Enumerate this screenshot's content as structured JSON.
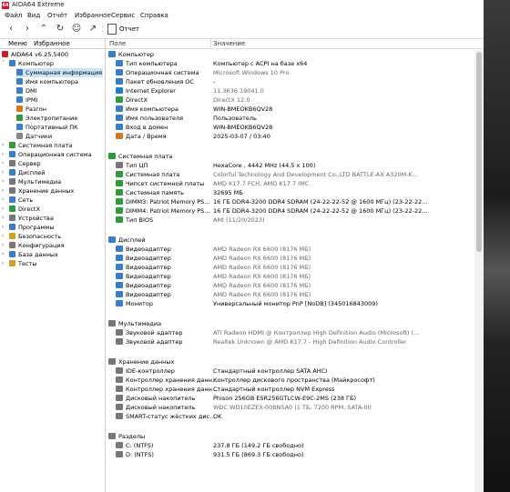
{
  "app": {
    "title": "AIDA64 Extreme",
    "icon_text": "64"
  },
  "menu": [
    "Файл",
    "Вид",
    "Отчёт",
    "Избранное",
    "Сервис",
    "Справка"
  ],
  "toolbar": {
    "report_label": "Отчет"
  },
  "sidebar": {
    "tabs": [
      "Меню",
      "Избранное"
    ],
    "tree": [
      {
        "label": "AIDA64 v6.25.5400",
        "icon": "aida-icon",
        "color": "#c8202b",
        "level": 0
      },
      {
        "label": "Компьютер",
        "icon": "computer-icon",
        "color": "#3a7ec9",
        "level": 1,
        "expanded": true
      },
      {
        "label": "Суммарная информация",
        "icon": "summary-icon",
        "color": "#3a7ec9",
        "level": 2,
        "selected": true
      },
      {
        "label": "Имя компьютера",
        "icon": "computer-name-icon",
        "color": "#3a7ec9",
        "level": 2
      },
      {
        "label": "DMI",
        "icon": "dmi-icon",
        "color": "#3a7ec9",
        "level": 2
      },
      {
        "label": "IPMI",
        "icon": "ipmi-icon",
        "color": "#3a7ec9",
        "level": 2
      },
      {
        "label": "Разгон",
        "icon": "overclock-icon",
        "color": "#d07b1f",
        "level": 2
      },
      {
        "label": "Электропитание",
        "icon": "power-icon",
        "color": "#2f9a3a",
        "level": 2
      },
      {
        "label": "Портативный ПК",
        "icon": "laptop-icon",
        "color": "#3a7ec9",
        "level": 2
      },
      {
        "label": "Датчики",
        "icon": "sensor-icon",
        "color": "#888888",
        "level": 2
      },
      {
        "label": "Системная плата",
        "icon": "motherboard-icon",
        "color": "#2f9a3a",
        "level": 1
      },
      {
        "label": "Операционная система",
        "icon": "os-icon",
        "color": "#3a7ec9",
        "level": 1
      },
      {
        "label": "Сервер",
        "icon": "server-icon",
        "color": "#777777",
        "level": 1
      },
      {
        "label": "Дисплей",
        "icon": "display-icon",
        "color": "#3a7ec9",
        "level": 1
      },
      {
        "label": "Мультимедиа",
        "icon": "multimedia-icon",
        "color": "#777777",
        "level": 1
      },
      {
        "label": "Хранение данных",
        "icon": "storage-icon",
        "color": "#777777",
        "level": 1
      },
      {
        "label": "Сеть",
        "icon": "network-icon",
        "color": "#3a7ec9",
        "level": 1
      },
      {
        "label": "DirectX",
        "icon": "directx-icon",
        "color": "#2f9a3a",
        "level": 1
      },
      {
        "label": "Устройства",
        "icon": "devices-icon",
        "color": "#777777",
        "level": 1
      },
      {
        "label": "Программы",
        "icon": "programs-icon",
        "color": "#3a7ec9",
        "level": 1
      },
      {
        "label": "Безопасность",
        "icon": "security-icon",
        "color": "#d0a21f",
        "level": 1
      },
      {
        "label": "Конфигурация",
        "icon": "config-icon",
        "color": "#777777",
        "level": 1
      },
      {
        "label": "База данных",
        "icon": "database-icon",
        "color": "#3a7ec9",
        "level": 1
      },
      {
        "label": "Тесты",
        "icon": "tests-icon",
        "color": "#d0a21f",
        "level": 1
      }
    ]
  },
  "columns": {
    "field": "Поле",
    "value": "Значение"
  },
  "sections": [
    {
      "title": "Компьютер",
      "icon": "computer-icon",
      "color": "#3a7ec9",
      "rows": [
        {
          "field": "Тип компьютера",
          "value": "Компьютер с ACPI на базе x64",
          "icon": "computer-type-icon",
          "color": "#3a7ec9"
        },
        {
          "field": "Операционная система",
          "value": "Microsoft Windows 10 Pro",
          "icon": "os-icon",
          "color": "#3a7ec9",
          "gray": true
        },
        {
          "field": "Пакет обновления ОС",
          "value": "-",
          "icon": "update-icon",
          "color": "#3a7ec9"
        },
        {
          "field": "Internet Explorer",
          "value": "11.3636.19041.0",
          "icon": "ie-icon",
          "color": "#1c7fd1",
          "gray": true
        },
        {
          "field": "DirectX",
          "value": "DirectX 12.0",
          "icon": "directx-icon",
          "color": "#2f9a3a",
          "gray": true
        },
        {
          "field": "Имя компьютера",
          "value": "WIN-BMEOKB6QV28",
          "icon": "computer-name-icon",
          "color": "#3a7ec9"
        },
        {
          "field": "Имя пользователя",
          "value": "Пользователь",
          "icon": "user-icon",
          "color": "#3a7ec9"
        },
        {
          "field": "Вход в домен",
          "value": "WIN-BMEOKB6QV28",
          "icon": "domain-icon",
          "color": "#3a7ec9"
        },
        {
          "field": "Дата / Время",
          "value": "2025-03-07 / 03:40",
          "icon": "calendar-icon",
          "color": "#d07b1f"
        }
      ]
    },
    {
      "title": "Системная плата",
      "icon": "motherboard-icon",
      "color": "#2f9a3a",
      "rows": [
        {
          "field": "Тип ЦП",
          "value": "HexaCore , 4442 MHz (44.5 x 100)",
          "icon": "cpu-icon",
          "color": "#777777"
        },
        {
          "field": "Системная плата",
          "value": "Colorful Technology And Development Co.,LTD BATTLE-AX A320M-K...",
          "icon": "motherboard-icon",
          "color": "#2f9a3a",
          "gray": true
        },
        {
          "field": "Чипсет системной платы",
          "value": "AMD K17.7 FCH, AMD K17.7 IMC",
          "icon": "chipset-icon",
          "color": "#2f9a3a",
          "gray": true
        },
        {
          "field": "Системная память",
          "value": "32695 МБ",
          "icon": "memory-icon",
          "color": "#2f9a3a"
        },
        {
          "field": "DIMM3: Patriot Memory PS...",
          "value": "16 ГБ DDR4-3200 DDR4 SDRAM  (24-22-22-52 @ 1600 МГц)  (23-22-22...",
          "icon": "dimm-icon",
          "color": "#2f9a3a"
        },
        {
          "field": "DIMM4: Patriot Memory PS...",
          "value": "16 ГБ DDR4-3200 DDR4 SDRAM  (24-22-22-52 @ 1600 МГц)  (23-22-22...",
          "icon": "dimm-icon",
          "color": "#2f9a3a"
        },
        {
          "field": "Тип BIOS",
          "value": "AMI (11/20/2023)",
          "icon": "bios-icon",
          "color": "#2f9a3a",
          "gray": true
        }
      ]
    },
    {
      "title": "Дисплей",
      "icon": "display-icon",
      "color": "#3a7ec9",
      "rows": [
        {
          "field": "Видеоадаптер",
          "value": "AMD Radeon RX 6600  (8176 МБ)",
          "icon": "gpu-icon",
          "color": "#3a7ec9",
          "gray": true
        },
        {
          "field": "Видеоадаптер",
          "value": "AMD Radeon RX 6600  (8176 МБ)",
          "icon": "gpu-icon",
          "color": "#3a7ec9",
          "gray": true
        },
        {
          "field": "Видеоадаптер",
          "value": "AMD Radeon RX 6600  (8176 МБ)",
          "icon": "gpu-icon",
          "color": "#3a7ec9",
          "gray": true
        },
        {
          "field": "Видеоадаптер",
          "value": "AMD Radeon RX 6600  (8176 МБ)",
          "icon": "gpu-icon",
          "color": "#3a7ec9",
          "gray": true
        },
        {
          "field": "Видеоадаптер",
          "value": "AMD Radeon RX 6600  (8176 МБ)",
          "icon": "gpu-icon",
          "color": "#3a7ec9",
          "gray": true
        },
        {
          "field": "Видеоадаптер",
          "value": "AMD Radeon RX 6600  (8176 МБ)",
          "icon": "gpu-icon",
          "color": "#3a7ec9",
          "gray": true
        },
        {
          "field": "Монитор",
          "value": "Универсальный монитор PnP [NoDB]  (345016843009)",
          "icon": "monitor-icon",
          "color": "#3a7ec9"
        }
      ]
    },
    {
      "title": "Мультимедиа",
      "icon": "multimedia-icon",
      "color": "#777777",
      "rows": [
        {
          "field": "Звуковой адаптер",
          "value": "ATI Radeon HDMI @ Контроллер High Definition Audio (Microsoft) (...",
          "icon": "audio-icon",
          "color": "#777777",
          "gray": true
        },
        {
          "field": "Звуковой адаптер",
          "value": "Realtek Unknown @ AMD K17.7 - High Definition Audio Controller",
          "icon": "audio-icon",
          "color": "#777777",
          "gray": true
        }
      ]
    },
    {
      "title": "Хранение данных",
      "icon": "storage-icon",
      "color": "#777777",
      "rows": [
        {
          "field": "IDE-контроллер",
          "value": "Стандартный контроллер SATA AHCI",
          "icon": "ide-icon",
          "color": "#777777"
        },
        {
          "field": "Контроллер хранения данн...",
          "value": "Контроллер дискового пространства (Майкрософт)",
          "icon": "storage-ctrl-icon",
          "color": "#777777"
        },
        {
          "field": "Контроллер хранения данн...",
          "value": "Стандартный контроллер NVM Express",
          "icon": "storage-ctrl-icon",
          "color": "#777777"
        },
        {
          "field": "Дисковый накопитель",
          "value": "Phison 256GB ESR256GTLCW-E9C-2MS  (238 ГБ)",
          "icon": "disk-icon",
          "color": "#777777"
        },
        {
          "field": "Дисковый накопитель",
          "value": "WDC WD10EZEX-00BN5A0  (1 ТБ, 7200 RPM, SATA-III)",
          "icon": "disk-icon",
          "color": "#777777",
          "gray": true
        },
        {
          "field": "SMART-статус жёстких дис...",
          "value": "OK",
          "icon": "smart-icon",
          "color": "#777777"
        }
      ]
    },
    {
      "title": "Разделы",
      "icon": "partition-icon",
      "color": "#777777",
      "rows": [
        {
          "field": "C: (NTFS)",
          "value": "237.8 ГБ (149.2 ГБ свободно)",
          "icon": "drive-icon",
          "color": "#777777"
        },
        {
          "field": "D: (NTFS)",
          "value": "931.5 ГБ (869.3 ГБ свободно)",
          "icon": "drive-icon",
          "color": "#777777"
        }
      ]
    }
  ]
}
